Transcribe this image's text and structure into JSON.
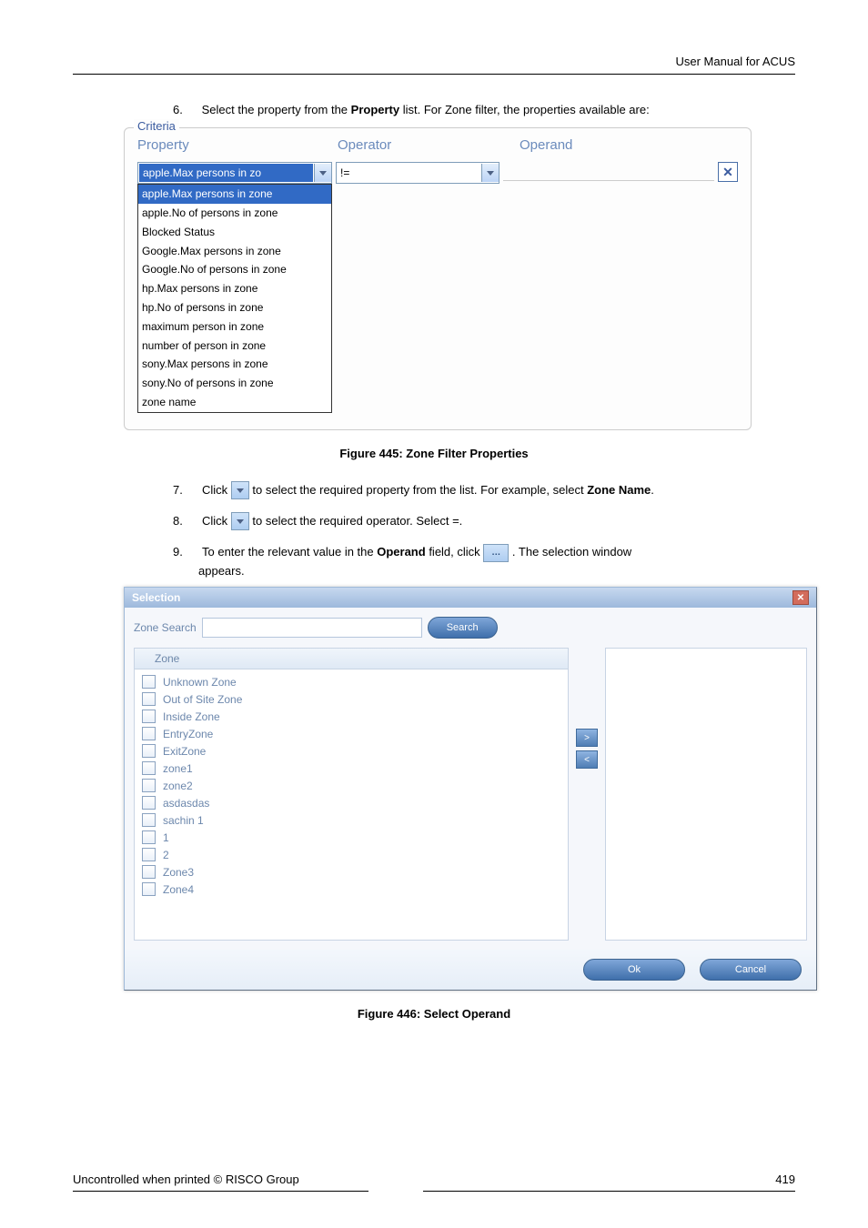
{
  "header": {
    "right": "User Manual for ACUS"
  },
  "step6": {
    "num": "6.",
    "pre": "Select the property from the ",
    "bold": "Property",
    "post": " list. For Zone filter, the properties available are:"
  },
  "criteria": {
    "legend": "Criteria",
    "headers": {
      "property": "Property",
      "operator": "Operator",
      "operand": "Operand"
    },
    "property_value": "apple.Max persons in zo",
    "operator_value": "!=",
    "dropdown": [
      "apple.Max persons in zone",
      "apple.No of persons in zone",
      "Blocked Status",
      "Google.Max persons in zone",
      "Google.No of persons in zone",
      "hp.Max persons in zone",
      "hp.No of persons in zone",
      "maximum person in zone",
      "number of person in zone",
      "sony.Max persons in zone",
      "sony.No of persons in zone",
      "zone name"
    ]
  },
  "figure445": "Figure 445: Zone Filter Properties",
  "step7": {
    "num": "7.",
    "a": "Click ",
    "b": " to select the required property from the list. For example, select ",
    "bold": "Zone Name",
    "c": "."
  },
  "step8": {
    "num": "8.",
    "a": "Click ",
    "b": " to select the required operator. Select =."
  },
  "step9": {
    "num": "9.",
    "a": "To enter the relevant value in the ",
    "bold": "Operand",
    "b": " field, click ",
    "c": ". The selection window",
    "d": "appears."
  },
  "selection": {
    "title": "Selection",
    "search_label": "Zone Search",
    "search_btn": "Search",
    "list_header": "Zone",
    "items": [
      "Unknown Zone",
      "Out of Site Zone",
      "Inside Zone",
      "EntryZone",
      "ExitZone",
      "zone1",
      "zone2",
      "asdasdas",
      "sachin 1",
      "1",
      "2",
      "Zone3",
      "Zone4"
    ],
    "move_right": ">",
    "move_left": "<",
    "ok": "Ok",
    "cancel": "Cancel"
  },
  "figure446": "Figure 446: Select Operand",
  "footer": {
    "left": "Uncontrolled when printed © RISCO Group",
    "right": "419"
  }
}
